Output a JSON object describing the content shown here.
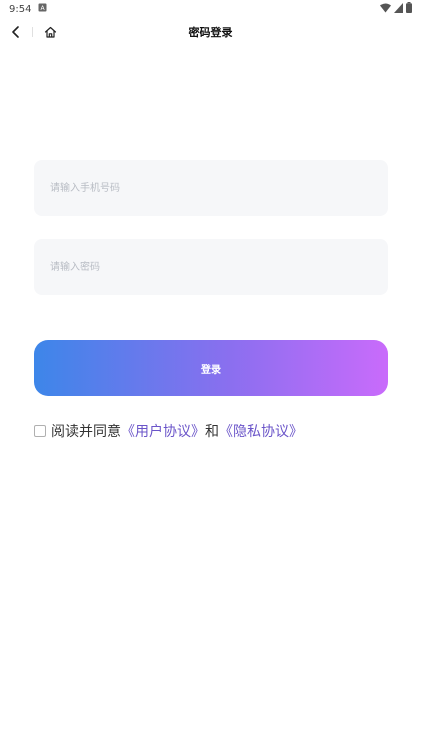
{
  "status_bar": {
    "time": "9:54"
  },
  "nav": {
    "title": "密码登录"
  },
  "form": {
    "phone_placeholder": "请输入手机号码",
    "password_placeholder": "请输入密码",
    "login_label": "登录"
  },
  "agreement": {
    "text_prefix": "阅读并同意",
    "user_agreement": "《用户协议》",
    "conjunction": "和",
    "privacy_policy": "《隐私协议》",
    "checked": false
  },
  "colors": {
    "gradient_start": "#3d86e9",
    "gradient_end": "#c96bfb",
    "link": "#6b55c9",
    "field_bg": "#f6f7f9"
  },
  "icons": [
    "notification-icon",
    "wifi-icon",
    "signal-icon",
    "battery-icon",
    "back-arrow-icon",
    "home-icon"
  ]
}
